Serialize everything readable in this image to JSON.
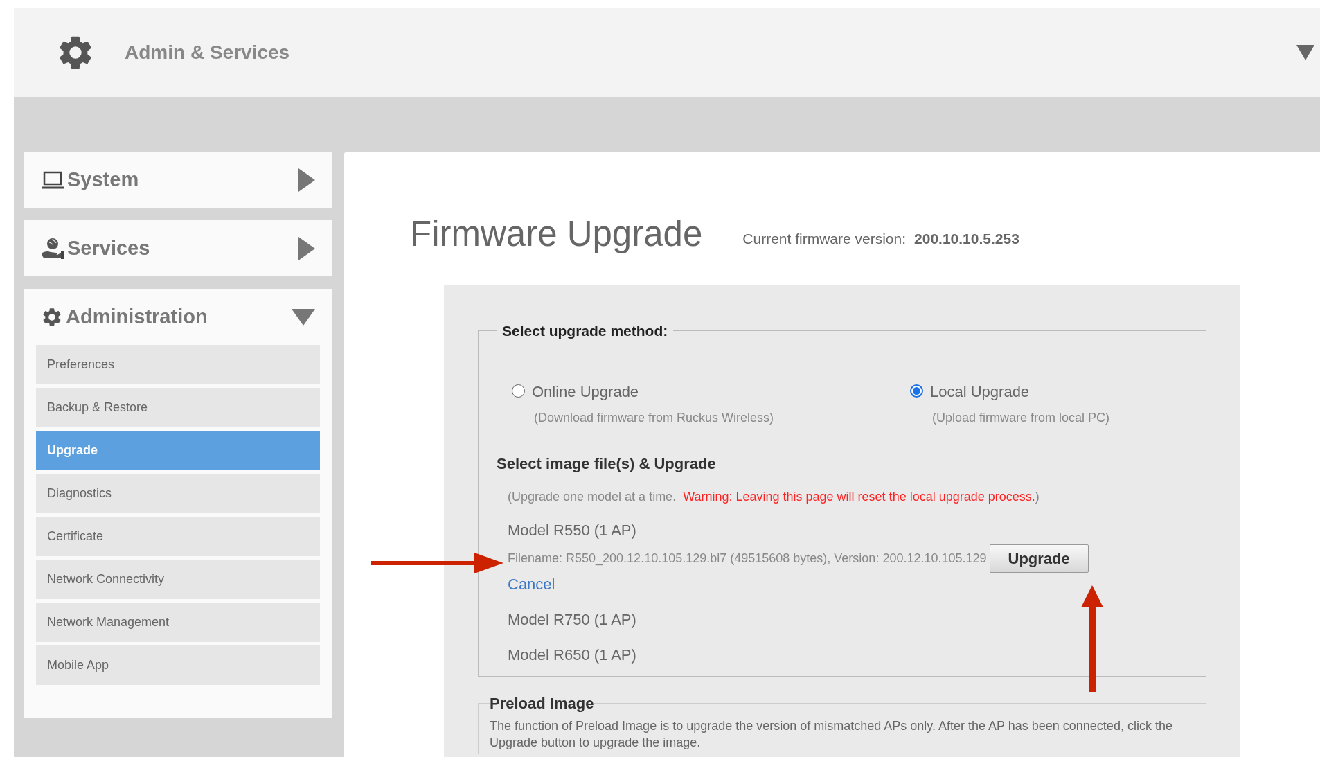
{
  "header": {
    "title": "Admin & Services"
  },
  "sidebar": [
    {
      "label": "System",
      "expanded": false
    },
    {
      "label": "Services",
      "expanded": false
    },
    {
      "label": "Administration",
      "expanded": true,
      "items": [
        {
          "label": "Preferences",
          "selected": false
        },
        {
          "label": "Backup & Restore",
          "selected": false
        },
        {
          "label": "Upgrade",
          "selected": true
        },
        {
          "label": "Diagnostics",
          "selected": false
        },
        {
          "label": "Certificate",
          "selected": false
        },
        {
          "label": "Network Connectivity",
          "selected": false
        },
        {
          "label": "Network Management",
          "selected": false
        },
        {
          "label": "Mobile App",
          "selected": false
        }
      ]
    }
  ],
  "page": {
    "title": "Firmware Upgrade",
    "firmware_label": "Current firmware version:",
    "firmware_version": "200.10.10.5.253"
  },
  "upgrade_method": {
    "legend": "Select upgrade method:",
    "options": [
      {
        "label": "Online Upgrade",
        "hint": "(Download firmware from Ruckus Wireless)",
        "selected": false
      },
      {
        "label": "Local Upgrade",
        "hint": "(Upload firmware from local PC)",
        "selected": true
      }
    ]
  },
  "image_section": {
    "title": "Select image file(s) & Upgrade",
    "note": "(Upgrade one model at a time.",
    "warning": "Warning: Leaving this page will reset the local upgrade process.",
    "note_end": ")",
    "models": [
      {
        "name": "Model R550 (1 AP)",
        "file": {
          "info": "Filename: R550_200.12.10.105.129.bl7 (49515608 bytes), Version: 200.12.10.105.129",
          "button": "Upgrade",
          "cancel": "Cancel"
        }
      },
      {
        "name": "Model R750 (1 AP)"
      },
      {
        "name": "Model R650 (1 AP)"
      }
    ]
  },
  "preload": {
    "legend": "Preload Image",
    "text": "The function of Preload Image is to upgrade the version of mismatched APs only. After the AP has been connected, click the Upgrade button to upgrade the image."
  }
}
